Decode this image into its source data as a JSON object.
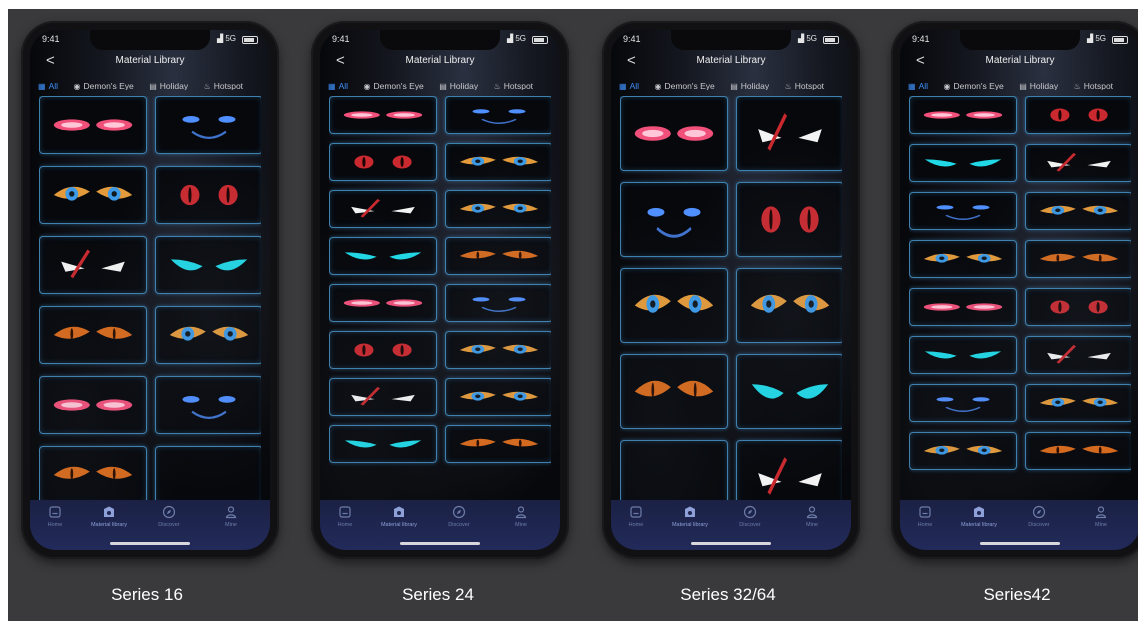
{
  "phone": {
    "time": "9:41",
    "signal": "5G",
    "title": "Material Library",
    "back": "<",
    "tabs": [
      {
        "icon": "▦",
        "label": "All"
      },
      {
        "icon": "◉",
        "label": "Demon's Eye"
      },
      {
        "icon": "▤",
        "label": "Holiday"
      },
      {
        "icon": "♨",
        "label": "Hotspot"
      }
    ],
    "bottom_nav": [
      "Home",
      "Material library",
      "Discover",
      "Mine"
    ]
  },
  "colors": {
    "pink": "#f0507a",
    "blue": "#4f8fff",
    "orange": "#d76a1c",
    "amber_blue": "#3c9ae8",
    "red": "#c9292f",
    "cyan": "#20d8e6",
    "white_red": "#ffffff",
    "tab_active": "#3d8ef7",
    "card_glow": "#50aae6"
  },
  "phones": [
    {
      "caption": "Series 16",
      "eyes": [
        "pink",
        "blue_smile",
        "amber_blue",
        "red_cat",
        "white_red",
        "cyan",
        "orange",
        "amber_blue",
        "pink",
        "blue_smile",
        "orange",
        "dark"
      ]
    },
    {
      "caption": "Series 24",
      "eyes": [
        "pink",
        "blue_smile",
        "red_cat",
        "amber_blue",
        "white_red",
        "amber_blue",
        "cyan",
        "orange",
        "pink",
        "blue_smile",
        "red_cat",
        "amber_blue",
        "white_red",
        "amber_blue",
        "cyan",
        "orange"
      ]
    },
    {
      "caption": "Series 32/64",
      "eyes": [
        "pink",
        "white_red",
        "blue_smile",
        "red_cat",
        "amber_blue",
        "amber_blue",
        "orange",
        "cyan",
        "dark",
        "white_red"
      ]
    },
    {
      "caption": "Series42",
      "eyes": [
        "pink",
        "red_cat",
        "cyan",
        "white_red",
        "blue_smile",
        "amber_blue",
        "amber_blue",
        "orange",
        "pink",
        "red_cat",
        "cyan",
        "white_red",
        "blue_smile",
        "amber_blue",
        "amber_blue",
        "orange"
      ]
    }
  ]
}
